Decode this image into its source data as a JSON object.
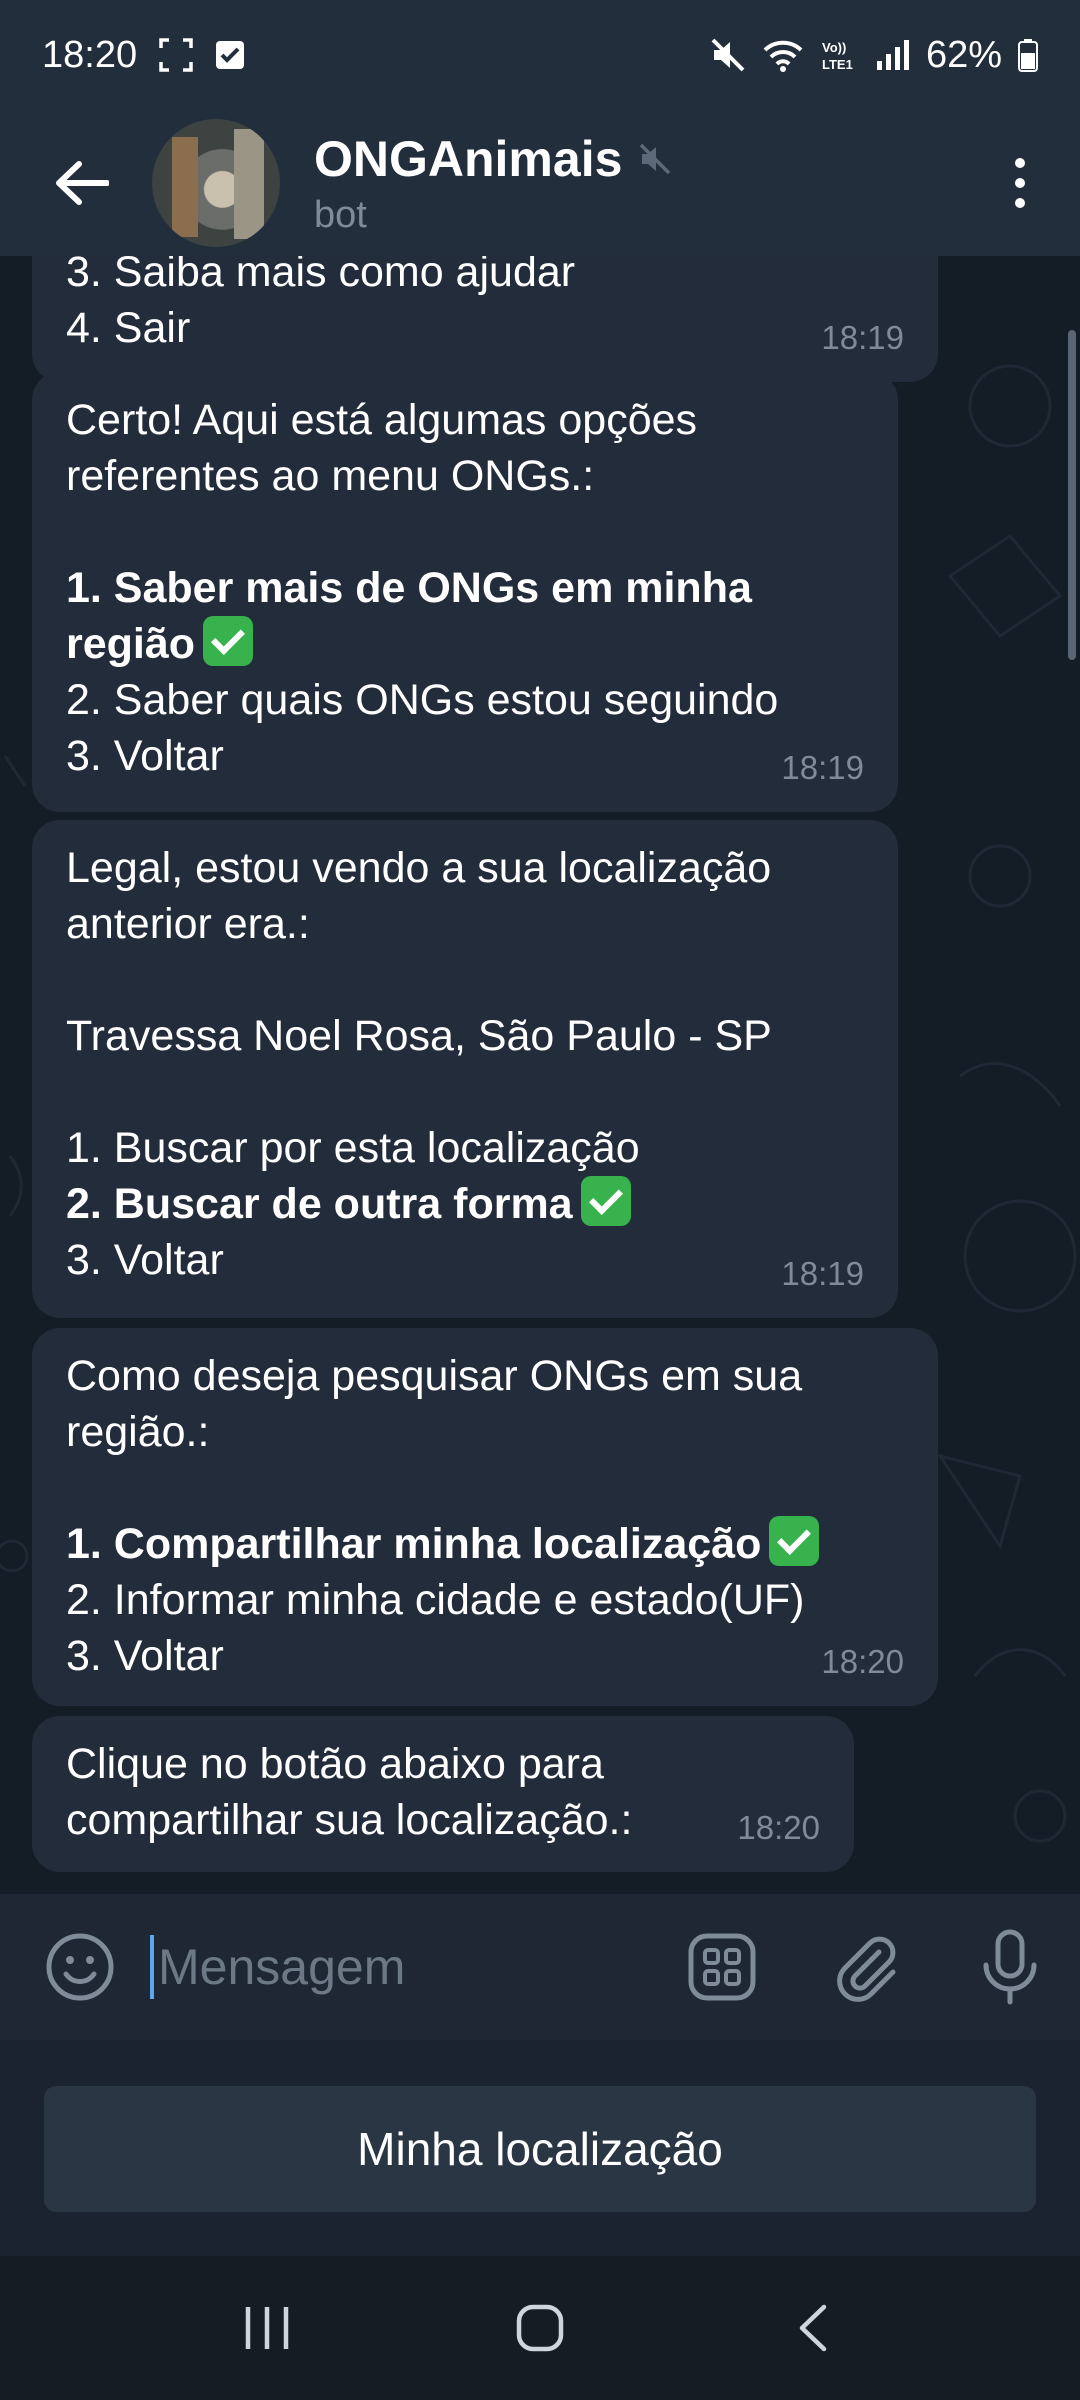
{
  "status_bar": {
    "time": "18:20",
    "battery": "62%",
    "icons": [
      "screenshot-icon",
      "checkbox-icon",
      "mute-icon",
      "wifi-icon",
      "volte-icon",
      "signal-icon",
      "battery-icon"
    ]
  },
  "header": {
    "title": "ONGAnimais",
    "subtitle": "bot",
    "icons": [
      "back-arrow-icon",
      "muted-speaker-icon",
      "more-vert-icon"
    ]
  },
  "messages": [
    {
      "lines": [
        {
          "text": "3. Saiba mais como ajudar",
          "bold": false
        },
        {
          "text": "4. Sair",
          "bold": false
        }
      ],
      "time": "18:19"
    },
    {
      "lines": [
        {
          "text": "Certo! Aqui está algumas opções",
          "bold": false
        },
        {
          "text": "referentes ao menu ONGs.:",
          "bold": false
        },
        {
          "text": "",
          "bold": false
        },
        {
          "text": "1. Saber mais de ONGs em minha",
          "bold": true
        },
        {
          "text": "região",
          "bold": true,
          "check": true
        },
        {
          "text": "2. Saber quais ONGs estou seguindo",
          "bold": false
        },
        {
          "text": "3. Voltar",
          "bold": false
        }
      ],
      "time": "18:19"
    },
    {
      "lines": [
        {
          "text": "Legal, estou vendo a sua localização",
          "bold": false
        },
        {
          "text": "anterior era.:",
          "bold": false
        },
        {
          "text": "",
          "bold": false
        },
        {
          "text": "Travessa Noel Rosa, São Paulo - SP",
          "bold": false
        },
        {
          "text": "",
          "bold": false
        },
        {
          "text": "1. Buscar por esta localização",
          "bold": false
        },
        {
          "text": "2. Buscar de outra forma",
          "bold": true,
          "check": true
        },
        {
          "text": "3. Voltar",
          "bold": false
        }
      ],
      "time": "18:19"
    },
    {
      "lines": [
        {
          "text": "Como deseja pesquisar ONGs em sua",
          "bold": false
        },
        {
          "text": "região.:",
          "bold": false
        },
        {
          "text": "",
          "bold": false
        },
        {
          "text": "1. Compartilhar minha localização",
          "bold": true,
          "check": true
        },
        {
          "text": "2. Informar minha cidade e estado(UF)",
          "bold": false
        },
        {
          "text": "3. Voltar",
          "bold": false
        }
      ],
      "time": "18:20"
    },
    {
      "lines": [
        {
          "text": "Clique no botão abaixo para",
          "bold": false
        },
        {
          "text": "compartilhar sua localização.:",
          "bold": false
        }
      ],
      "time": "18:20"
    }
  ],
  "input": {
    "placeholder": "Mensagem",
    "icons": [
      "emoji-icon",
      "bot-commands-icon",
      "attach-icon",
      "microphone-icon"
    ]
  },
  "keyboard": {
    "button_label": "Minha localização"
  },
  "nav": {
    "icons": [
      "recents-icon",
      "home-icon",
      "back-icon"
    ]
  }
}
